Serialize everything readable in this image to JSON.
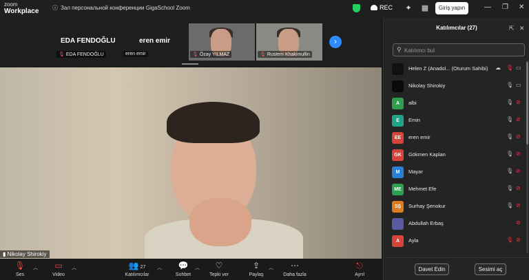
{
  "app": {
    "logo_line1": "zoom",
    "logo_line2": "Workplace",
    "meeting_title": "Зал персональной конференции GigaSchool Zoom",
    "rec_label": "REC",
    "sign_in": "Giriş yapın",
    "window_controls": [
      "—",
      "❐",
      "✕"
    ]
  },
  "strip": {
    "tiles": [
      {
        "name": "EDA FENDOĞLU",
        "tag": "EDA FENDOĞLU",
        "muted": true
      },
      {
        "name": "eren emir",
        "tag": "eren emir",
        "muted": false
      }
    ],
    "video_tiles": [
      {
        "tag": "Özay YILMAZ",
        "muted": true
      },
      {
        "tag": "Rustem Khakimullin",
        "muted": true
      }
    ],
    "next_icon": "chevron-right-icon"
  },
  "main_video": {
    "label": "Nikolay Shirokiy"
  },
  "toolbar": {
    "buttons": [
      {
        "label": "Ses",
        "icon": "mic-off-icon",
        "red": true
      },
      {
        "label": "Video",
        "icon": "video-off-icon",
        "red": true
      },
      {
        "label": "Katılımcılar",
        "icon": "participants-icon",
        "count": "27"
      },
      {
        "label": "Sohbet",
        "icon": "chat-icon"
      },
      {
        "label": "Tepki ver",
        "icon": "heart-icon"
      },
      {
        "label": "Paylaş",
        "icon": "share-icon"
      },
      {
        "label": "Daha fazla",
        "icon": "more-icon"
      },
      {
        "label": "Ayrıl",
        "icon": "leave-icon"
      }
    ]
  },
  "panel": {
    "title": "Katılımcılar (27)",
    "search_placeholder": "Katılımcı bul",
    "participants": [
      {
        "name": "Helen Z (Anadol... (Oturum Sahibi)",
        "avatar": "",
        "color": "#111111",
        "mic": "muted",
        "cam": "on",
        "cloud": true
      },
      {
        "name": "Nikolay Shirokiy",
        "avatar": "",
        "color": "#0a0a0a",
        "mic": "on",
        "cam": "on"
      },
      {
        "name": "albi",
        "avatar": "A",
        "color": "#2e9e4f",
        "mic": "on",
        "cam": "off"
      },
      {
        "name": "Emin",
        "avatar": "E",
        "color": "#1fa38a",
        "mic": "on",
        "cam": "off"
      },
      {
        "name": "eren emir",
        "avatar": "EE",
        "color": "#d6453b",
        "mic": "on",
        "cam": "off"
      },
      {
        "name": "Gökmen Kaplan",
        "avatar": "GK",
        "color": "#d6453b",
        "mic": "on",
        "cam": "off"
      },
      {
        "name": "Mayar",
        "avatar": "M",
        "color": "#2a7fd4",
        "mic": "on",
        "cam": "off"
      },
      {
        "name": "Mehmet Efe",
        "avatar": "ME",
        "color": "#2e9e4f",
        "mic": "on",
        "cam": "off"
      },
      {
        "name": "Surhay Şenokur",
        "avatar": "SŞ",
        "color": "#e07a1f",
        "mic": "on",
        "cam": "off"
      },
      {
        "name": "Abdullah Erbaş",
        "avatar": "",
        "color": "#5a5aa0",
        "mic": "none",
        "cam": "off"
      },
      {
        "name": "Ayla",
        "avatar": "A",
        "color": "#d6453b",
        "mic": "muted",
        "cam": "off"
      }
    ],
    "invite_label": "Davet Edin",
    "unmute_label": "Sesimi aç"
  }
}
